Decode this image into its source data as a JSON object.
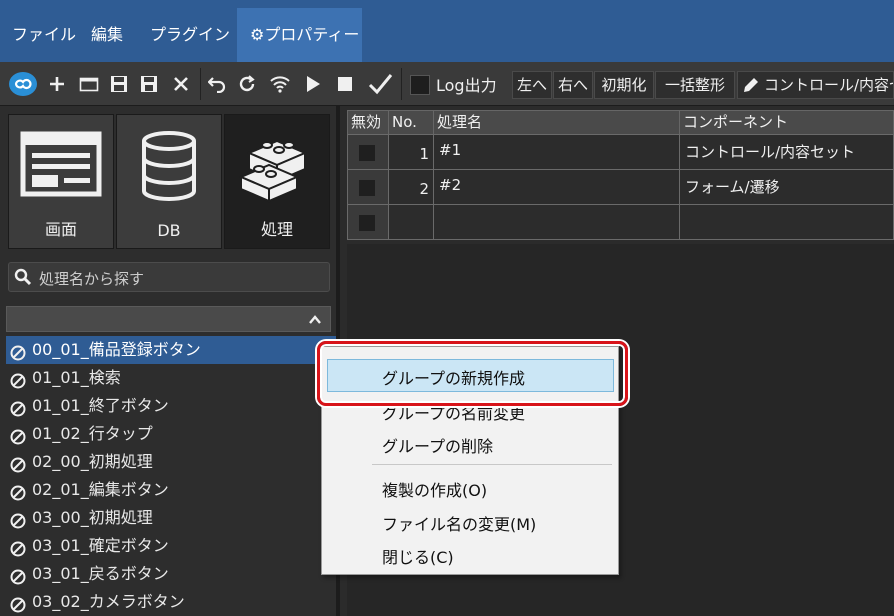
{
  "menubar": {
    "items": [
      "ファイル",
      "編集",
      "プラグイン"
    ],
    "active_tab": "⚙プロパティー"
  },
  "toolbar": {
    "log_label": "Log出力",
    "left_label": "左へ",
    "right_label": "右へ",
    "init_label": "初期化",
    "format_label": "一括整形",
    "control_label": "コントロール/内容セ"
  },
  "categories": [
    {
      "label": "画面",
      "icon": "screen-icon"
    },
    {
      "label": "DB",
      "icon": "database-icon"
    },
    {
      "label": "処理",
      "icon": "blocks-icon"
    }
  ],
  "search": {
    "placeholder": "処理名から探す"
  },
  "tree": {
    "items": [
      "00_01_備品登録ボタン",
      "01_01_検索",
      "01_01_終了ボタン",
      "01_02_行タップ",
      "02_00_初期処理",
      "02_01_編集ボタン",
      "03_00_初期処理",
      "03_01_確定ボタン",
      "03_01_戻るボタン",
      "03_02_カメラボタン"
    ]
  },
  "grid": {
    "headers": [
      "無効",
      "No.",
      "処理名",
      "コンポーネント"
    ],
    "rows": [
      {
        "no": "1",
        "name": "#1",
        "component": "コントロール/内容セット"
      },
      {
        "no": "2",
        "name": "#2",
        "component": "フォーム/遷移"
      },
      {
        "no": "",
        "name": "",
        "component": ""
      }
    ]
  },
  "context_menu": {
    "items": [
      "グループの新規作成",
      "グループの名前変更",
      "グループの削除",
      "複製の作成(O)",
      "ファイル名の変更(M)",
      "閉じる(C)"
    ]
  },
  "colors": {
    "menubar": "#2f5c94",
    "selection": "#2f5c94",
    "highlight": "#cbe6f5",
    "callout": "#d8141a"
  }
}
